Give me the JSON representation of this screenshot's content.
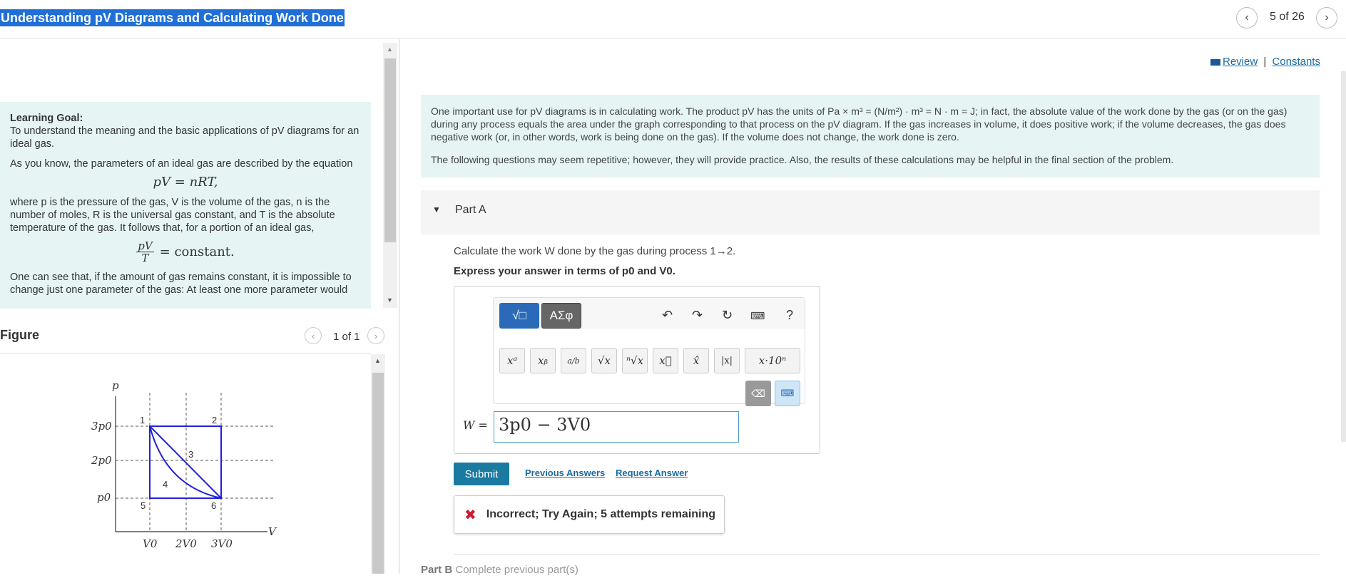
{
  "header": {
    "title": "Understanding pV Diagrams and Calculating Work Done",
    "page_counter": "5 of 26",
    "prev_icon": "chevron-left-icon",
    "next_icon": "chevron-right-icon"
  },
  "intro": {
    "learning_goal_heading": "Learning Goal:",
    "learning_goal_text": "To understand the meaning and the basic applications of pV diagrams for an ideal gas.",
    "p1": "As you know, the parameters of an ideal gas are described by the equation",
    "eq1": "pV = nRT,",
    "p2": "where p is the pressure of the gas, V is the volume of the gas, n is the number of moles, R is the universal gas constant, and T is the absolute temperature of the gas. It follows that, for a portion of an ideal gas,",
    "eq2_num": "pV",
    "eq2_den": "T",
    "eq2_rhs": "= constant.",
    "p3": "One can see that, if the amount of gas remains constant, it is impossible to change just one parameter of the gas: At least one more parameter would"
  },
  "figure": {
    "label": "Figure",
    "pager": "1 of 1",
    "axis_p": "p",
    "axis_v": "V",
    "y_ticks": [
      "3p0",
      "2p0",
      "p0"
    ],
    "x_ticks": [
      "V0",
      "2V0",
      "3V0"
    ],
    "points": [
      "1",
      "2",
      "3",
      "4",
      "5",
      "6"
    ]
  },
  "links": {
    "review": "Review",
    "separator": "|",
    "constants": "Constants"
  },
  "info": {
    "p1": "One important use for pV diagrams is in calculating work. The product pV has the units of Pa × m³ = (N/m²) · m³ = N · m = J; in fact, the absolute value of the work done by the gas (or on the gas) during any process equals the area under the graph corresponding to that process on the pV diagram. If the gas increases in volume, it does positive work; if the volume decreases, the gas does negative work (or, in other words, work is being done on the gas). If the volume does not change, the work done is zero.",
    "p2": "The following questions may seem repetitive; however, they will provide practice. Also, the results of these calculations may be helpful in the final section of the problem."
  },
  "part_a": {
    "label": "Part A",
    "question": "Calculate the work W done by the gas during process 1→2.",
    "instruction": "Express your answer in terms of p0 and V0.",
    "templates_label": "√□",
    "symbols_label": "ΑΣφ",
    "keys": [
      "xᵃ",
      "xᵦ",
      "a/b",
      "√x",
      "ⁿ√x",
      "x⃗",
      "x̂",
      "|x|",
      "x·10ⁿ"
    ],
    "help": "?",
    "answer_label": "W =",
    "answer_value": "3p0 − 3V0",
    "submit": "Submit",
    "previous_answers": "Previous Answers",
    "request_answer": "Request Answer",
    "feedback": "Incorrect; Try Again; 5 attempts remaining"
  },
  "part_b": {
    "label": "Part B",
    "status": "Complete previous part(s)"
  }
}
